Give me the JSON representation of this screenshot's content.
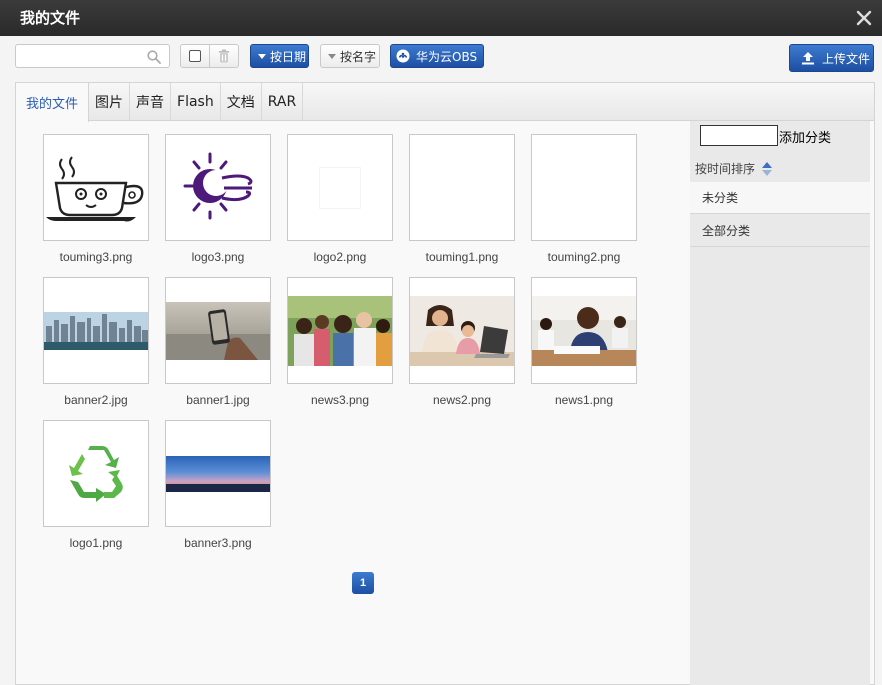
{
  "dialog": {
    "title": "我的文件",
    "close_icon": "close-icon"
  },
  "toolbar": {
    "search_placeholder": "",
    "sort_date_label": "按日期",
    "sort_name_label": "按名字",
    "obs_label": "华为云OBS",
    "upload_label": "上传文件"
  },
  "tabs": [
    "我的文件",
    "图片",
    "声音",
    "Flash",
    "文档",
    "RAR"
  ],
  "files": [
    {
      "name": "touming3.png",
      "image": "cup-drawing"
    },
    {
      "name": "logo3.png",
      "image": "purple-sun-moon-logo"
    },
    {
      "name": "logo2.png",
      "image": "blank-small"
    },
    {
      "name": "touming1.png",
      "image": "blank"
    },
    {
      "name": "touming2.png",
      "image": "blank"
    },
    {
      "name": "banner2.jpg",
      "image": "city-skyline-banner"
    },
    {
      "name": "banner1.jpg",
      "image": "phone-photo-beach"
    },
    {
      "name": "news3.png",
      "image": "children-group-photo"
    },
    {
      "name": "news2.png",
      "image": "mother-daughter-laptop"
    },
    {
      "name": "news1.png",
      "image": "classroom-boy-writing"
    },
    {
      "name": "logo1.png",
      "image": "recycle-logo"
    },
    {
      "name": "banner3.png",
      "image": "sunset-sky-banner"
    }
  ],
  "pagination": {
    "current": "1"
  },
  "sidebar": {
    "add_category_label": "添加分类",
    "sort_label": "按时间排序",
    "items": [
      "未分类",
      "全部分类"
    ]
  },
  "colors": {
    "accent": "#2a5db0",
    "titlebar": "#2f2f2f",
    "button_blue": "#1d4fa3"
  }
}
